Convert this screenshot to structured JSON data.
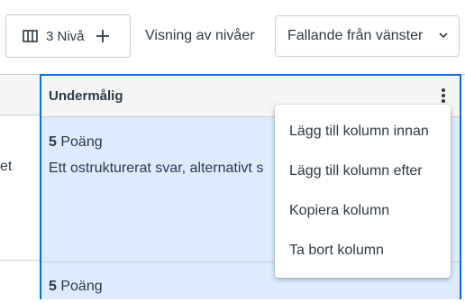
{
  "toolbar": {
    "levels_button_label": "3 Nivå",
    "view_label": "Visning av nivåer",
    "view_select_value": "Fallande från vänster"
  },
  "grid": {
    "left_cell_text": "et",
    "column": {
      "title": "Undermålig",
      "cells": [
        {
          "points": "5",
          "points_unit": "Poäng",
          "description": "Ett ostrukturerat svar, alternativt s"
        },
        {
          "points": "5",
          "points_unit": "Poäng"
        }
      ]
    }
  },
  "menu": {
    "items": [
      "Lägg till kolumn innan",
      "Lägg till kolumn efter",
      "Kopiera kolumn",
      "Ta bort kolumn"
    ]
  },
  "colors": {
    "accent": "#0b6ed9",
    "selected_column_bg": "#dcebff",
    "text": "#2d3b45",
    "border": "#c7cdd1"
  }
}
